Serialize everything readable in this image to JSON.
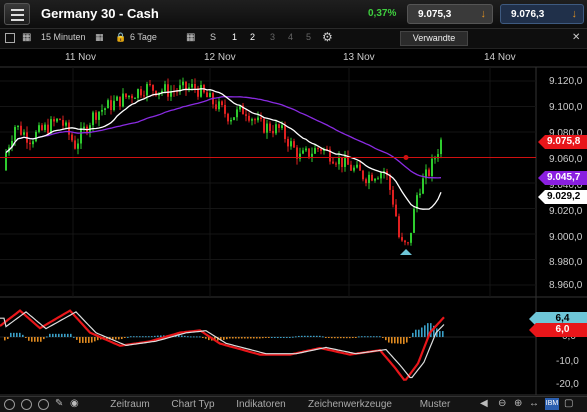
{
  "header": {
    "title": "Germany 30 - Cash",
    "change": "0,37%",
    "sell_price": "9.075,3",
    "buy_price": "9.076,3"
  },
  "toolbar": {
    "interval": "15 Minuten",
    "range": "6 Tage",
    "charts_label": "S",
    "layout_numbers": [
      "1",
      "2",
      "3",
      "4",
      "5"
    ],
    "related_label": "Verwandte"
  },
  "x_axis_labels": [
    "11 Nov",
    "12 Nov",
    "13 Nov",
    "14 Nov"
  ],
  "price_axis": {
    "ticks": [
      "9.120,0",
      "9.100,0",
      "9.080,0",
      "9.060,0",
      "9.040,0",
      "9.020,0",
      "9.000,0",
      "8.980,0",
      "8.960,0"
    ],
    "tag_current": "9.075,8",
    "tag_purple": "9.045,7",
    "tag_white": "9.029,2"
  },
  "indicator_axis": {
    "ticks": [
      "0,0",
      "-10,0",
      "-20,0"
    ],
    "tag_blue": "6,4",
    "tag_red": "6,0"
  },
  "bottom_bar": {
    "tabs": [
      "Zeitraum",
      "Chart Typ",
      "Indikatoren",
      "Zeichenwerkzeuge",
      "Muster"
    ]
  },
  "colors": {
    "up_candle": "#2ecc2e",
    "down_candle": "#e02020",
    "ma_purple": "#8a2be2",
    "current_line": "#d01010",
    "accent_buy": "#20304a"
  }
}
